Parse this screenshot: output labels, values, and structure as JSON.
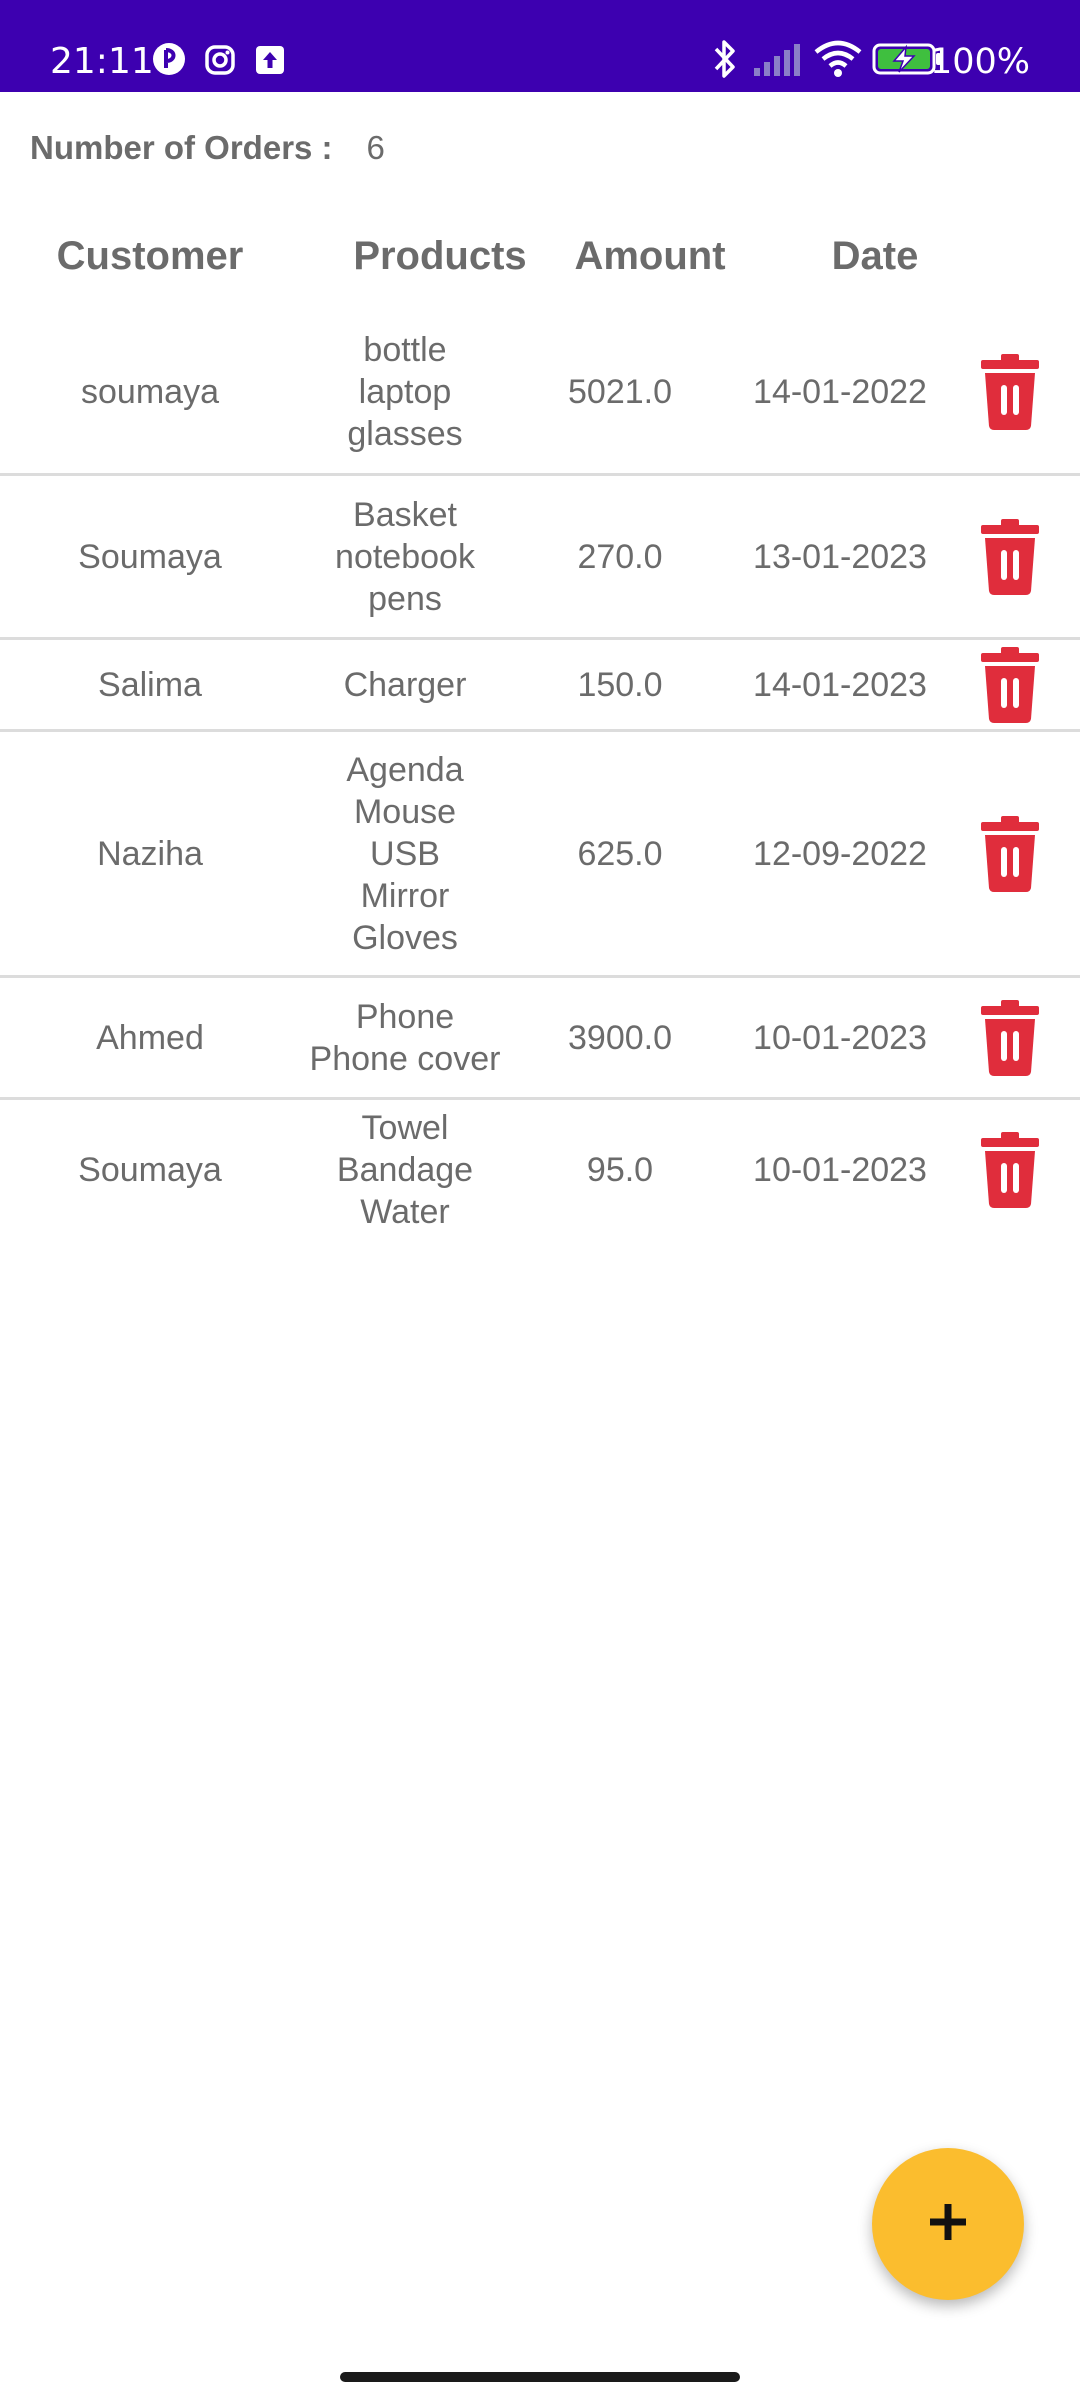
{
  "status_bar": {
    "time": "21:11",
    "battery_text": "100%",
    "background": "#3d00b0",
    "icons": [
      "pinterest-style-icon",
      "instagram-icon",
      "upload-icon",
      "bluetooth-icon",
      "signal-icon",
      "wifi-icon",
      "battery-charging-icon"
    ]
  },
  "orders": {
    "count_label": "Number of Orders :",
    "count_value": "6"
  },
  "table": {
    "headers": {
      "customer": "Customer",
      "products": "Products",
      "amount": "Amount",
      "date": "Date"
    },
    "rows": [
      {
        "customer": "soumaya",
        "products": [
          "bottle",
          "laptop",
          "glasses"
        ],
        "amount": "5021.0",
        "date": "14-01-2022"
      },
      {
        "customer": "Soumaya",
        "products": [
          "Basket",
          "notebook",
          "pens"
        ],
        "amount": "270.0",
        "date": "13-01-2023"
      },
      {
        "customer": "Salima",
        "products": [
          "Charger"
        ],
        "amount": "150.0",
        "date": "14-01-2023"
      },
      {
        "customer": "Naziha",
        "products": [
          "Agenda",
          "Mouse",
          "USB",
          "Mirror",
          "Gloves"
        ],
        "amount": "625.0",
        "date": "12-09-2022"
      },
      {
        "customer": "Ahmed",
        "products": [
          "Phone",
          "Phone cover"
        ],
        "amount": "3900.0",
        "date": "10-01-2023"
      },
      {
        "customer": "Soumaya",
        "products": [
          "Towel",
          "Bandage",
          "Water"
        ],
        "amount": "95.0",
        "date": "10-01-2023"
      }
    ]
  },
  "colors": {
    "accent_fab": "#fbbd2e",
    "delete_icon": "#e02d3c",
    "text": "#6b6b6b"
  },
  "fab": {
    "icon": "plus-icon"
  }
}
